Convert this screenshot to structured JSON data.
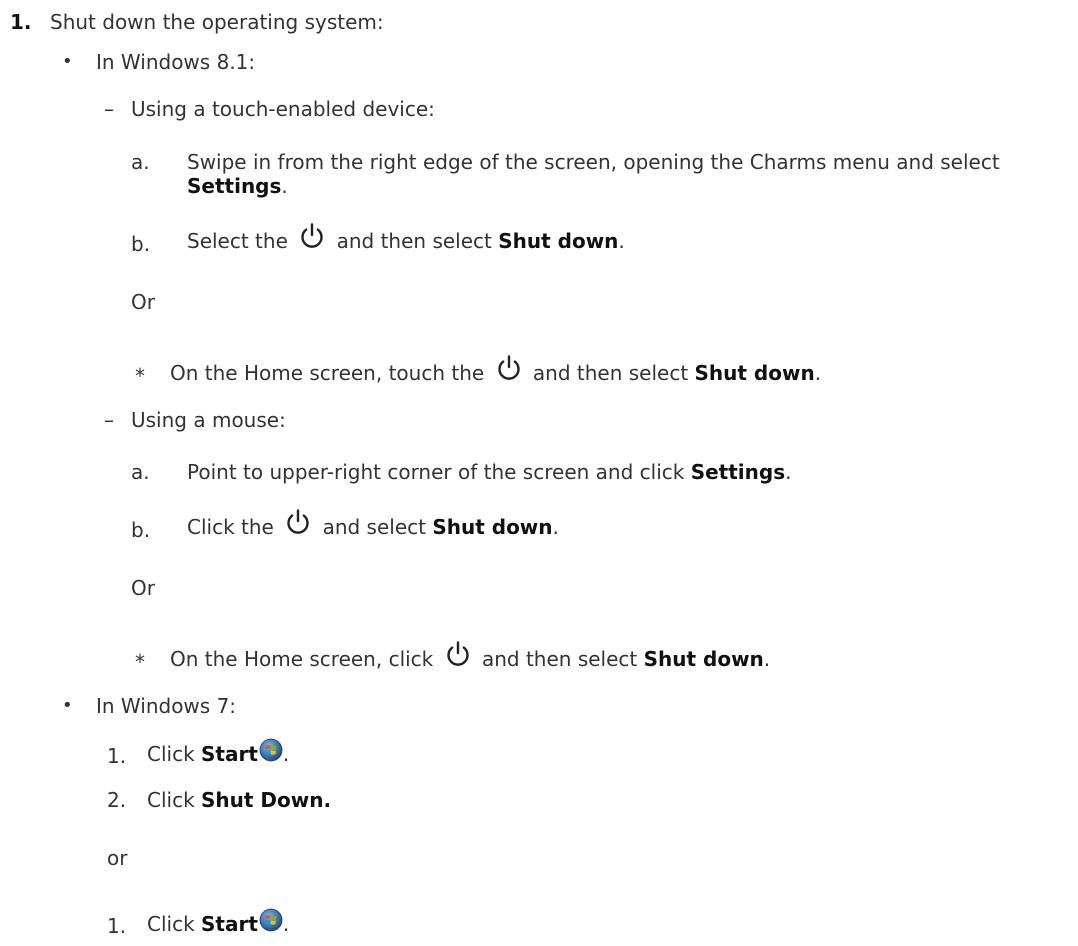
{
  "step": {
    "number": "1.",
    "text": "Shut down the operating system:"
  },
  "win81": {
    "label": "In Windows 8.1:",
    "touch": {
      "label": "Using a touch-enabled device:",
      "a_letter": "a.",
      "a_text": "Swipe in from the right edge of the screen, opening the Charms menu and select",
      "a_bold": "Settings",
      "a_end": ".",
      "b_letter": "b.",
      "b_pre": "Select the",
      "b_mid": "and then select",
      "b_bold": "Shut down",
      "b_end": ".",
      "or": "Or",
      "star_pre": "On the Home screen, touch the",
      "star_mid": "and then select",
      "star_bold": "Shut down",
      "star_end": "."
    },
    "mouse": {
      "label": "Using a mouse:",
      "a_letter": "a.",
      "a_pre": "Point to upper-right corner of the screen and click",
      "a_bold": "Settings",
      "a_end": ".",
      "b_letter": "b.",
      "b_pre": "Click the",
      "b_mid": "and select",
      "b_bold": "Shut down",
      "b_end": ".",
      "or": "Or",
      "star_pre": "On the Home screen, click",
      "star_mid": "and then select",
      "star_bold": "Shut down",
      "star_end": "."
    }
  },
  "win7": {
    "label": "In Windows 7:",
    "s1_num": "1.",
    "s1_pre": "Click",
    "s1_bold": "Start",
    "s1_end": ".",
    "s2_num": "2.",
    "s2_pre": "Click",
    "s2_bold": "Shut Down.",
    "or": "or",
    "s3_num": "1.",
    "s3_pre": "Click",
    "s3_bold": "Start",
    "s3_end": "."
  },
  "symbols": {
    "bullet": "•",
    "dash": "–",
    "star": "*"
  },
  "icons": {
    "power": "power-icon",
    "windows_start": "windows-start-orb-icon"
  },
  "colors": {
    "text": "#333333",
    "bold_text": "#111111",
    "background": "#ffffff"
  }
}
